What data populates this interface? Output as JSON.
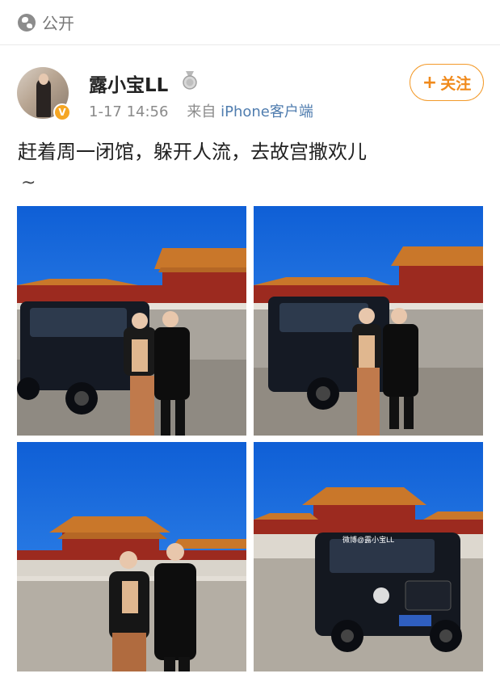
{
  "visibility": {
    "icon": "globe-icon",
    "label": "公开"
  },
  "post": {
    "user": {
      "name": "露小宝LL",
      "verified": true,
      "badge_icon": "medal-icon"
    },
    "date": "1-17 14:56",
    "source_prefix": "来自",
    "source": "iPhone客户端",
    "follow_button": {
      "plus": "+",
      "label": "关注"
    },
    "text": "赶着周一闭馆，躲开人流，去故宫撒欢儿",
    "text_tail": "~",
    "photos": [
      {
        "name": "photo-1",
        "alt": "two women posing in front of black SUV at Forbidden City"
      },
      {
        "name": "photo-2",
        "alt": "two women standing beside black SUV at Forbidden City"
      },
      {
        "name": "photo-3",
        "alt": "two women in winter coats in front of palace hall"
      },
      {
        "name": "photo-4",
        "alt": "black SUV parked in front of palace hall"
      }
    ],
    "watermark": "微博@露小宝LL"
  },
  "colors": {
    "accent_orange": "#f08a1c",
    "link_blue": "#507daf",
    "sky_blue": "#1e6fe0",
    "roof_gold": "#c9772a",
    "wall_red": "#9c2a1f"
  }
}
